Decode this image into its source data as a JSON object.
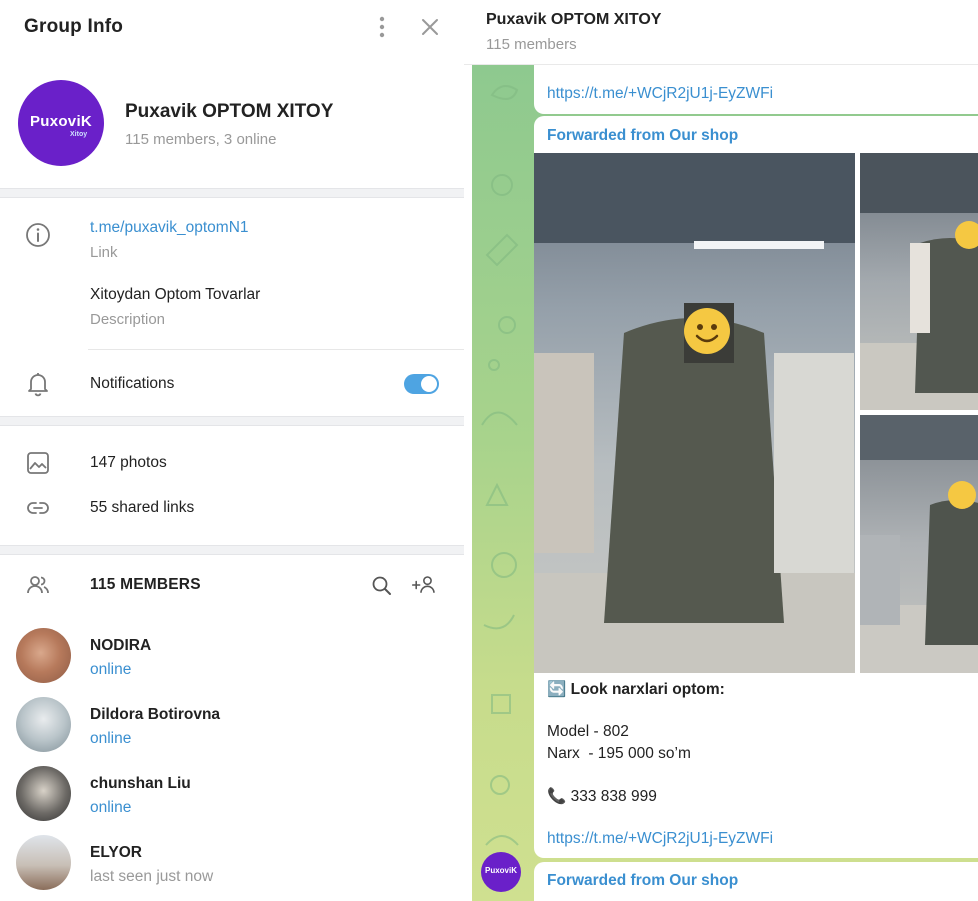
{
  "left_panel": {
    "header_title": "Group Info",
    "profile": {
      "avatar_text": "PuxoviK",
      "avatar_subtext": "Xitoy",
      "name": "Puxavik OPTOM XITOY",
      "members_line": "115 members, 3 online"
    },
    "info": {
      "link_value": "t.me/puxavik_optomN1",
      "link_label": "Link",
      "description_value": "Xitoydan Optom Tovarlar",
      "description_label": "Description",
      "notifications_label": "Notifications",
      "notifications_on": true
    },
    "media": {
      "photos": "147 photos",
      "links": "55 shared links"
    },
    "members": {
      "title": "115 MEMBERS",
      "list": [
        {
          "name": "NODIRA",
          "status": "online"
        },
        {
          "name": "Dildora Botirovna",
          "status": "online"
        },
        {
          "name": "chunshan Liu",
          "status": "online"
        },
        {
          "name": "ELYOR",
          "status": "last seen just now"
        }
      ]
    }
  },
  "chat": {
    "title": "Puxavik OPTOM XITOY",
    "subtitle": "115 members",
    "messages": {
      "top_link": "https://t.me/+WCjR2jU1j-EyZWFi",
      "forward_label": "Forwarded from Our shop",
      "caption_icon": "🔄",
      "caption_title": "Look narxlari optom:",
      "model": "Model - 802",
      "price": "Narx  - 195 000 so’m",
      "phone_icon": "📞",
      "phone": "333 838 999",
      "link": "https://t.me/+WCjR2jU1j-EyZWFi",
      "forward_label_2": "Forwarded from Our shop",
      "sender_avatar_text": "PuxoviK"
    }
  },
  "colors": {
    "accent": "#3a8fd0",
    "avatar_purple": "#6a20c9",
    "toggle": "#4ea4e2"
  }
}
